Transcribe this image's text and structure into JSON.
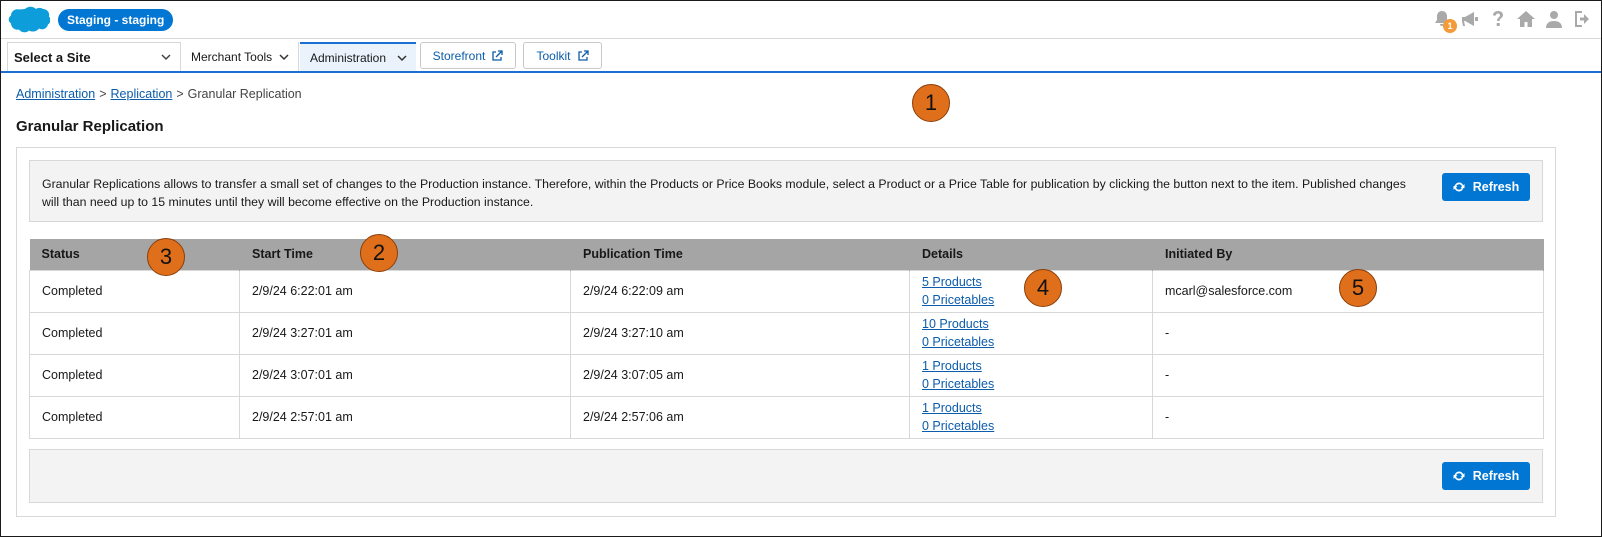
{
  "header": {
    "environment_badge": "Staging - staging",
    "notification_count": "1",
    "icons": [
      "bell-icon",
      "megaphone-icon",
      "help-icon",
      "home-icon",
      "user-icon",
      "logout-icon"
    ]
  },
  "nav": {
    "site_select": "Select a Site",
    "tabs": [
      {
        "label": "Merchant Tools"
      },
      {
        "label": "Administration"
      }
    ],
    "buttons": [
      {
        "label": "Storefront"
      },
      {
        "label": "Toolkit"
      }
    ]
  },
  "breadcrumb": {
    "items": [
      "Administration",
      "Replication",
      "Granular Replication"
    ],
    "separator": ">"
  },
  "page": {
    "title": "Granular Replication",
    "info_text": "Granular Replications allows to transfer a small set of changes to the Production instance. Therefore, within the Products or Price Books module, select a Product or a Price Table for publication by clicking the button next to the item. Published changes will than need up to 15 minutes until they will become effective on the Production instance.",
    "refresh_label": "Refresh"
  },
  "table": {
    "columns": [
      "Status",
      "Start Time",
      "Publication Time",
      "Details",
      "Initiated By"
    ],
    "rows": [
      {
        "status": "Completed",
        "start": "2/9/24  6:22:01 am",
        "publication": "2/9/24  6:22:09 am",
        "products": "5 Products",
        "pricetables": "0 Pricetables",
        "initiated_by": "mcarl@salesforce.com"
      },
      {
        "status": "Completed",
        "start": "2/9/24  3:27:01 am",
        "publication": "2/9/24  3:27:10 am",
        "products": "10 Products",
        "pricetables": "0 Pricetables",
        "initiated_by": "-"
      },
      {
        "status": "Completed",
        "start": "2/9/24  3:07:01 am",
        "publication": "2/9/24  3:07:05 am",
        "products": "1 Products",
        "pricetables": "0 Pricetables",
        "initiated_by": "-"
      },
      {
        "status": "Completed",
        "start": "2/9/24  2:57:01 am",
        "publication": "2/9/24  2:57:06 am",
        "products": "1 Products",
        "pricetables": "0 Pricetables",
        "initiated_by": "-"
      }
    ]
  },
  "callouts": [
    "1",
    "2",
    "3",
    "4",
    "5"
  ],
  "colors": {
    "brand_blue": "#0176d3",
    "callout_orange": "#e06f1c",
    "header_gray": "#a5a5a5",
    "link_blue": "#0b5cab"
  }
}
